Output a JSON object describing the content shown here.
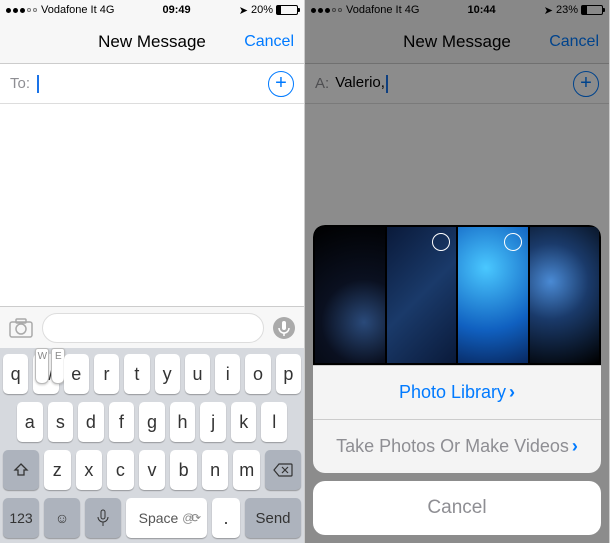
{
  "left": {
    "status": {
      "carrier": "Vodafone It 4G",
      "time": "09:49",
      "battery": "20%",
      "battery_fill": 20
    },
    "nav": {
      "title": "New Message",
      "cancel": "Cancel"
    },
    "to": {
      "label": "To:",
      "value": ""
    },
    "keyboard": {
      "row1": [
        "q",
        "w",
        "e",
        "r",
        "t",
        "y",
        "u",
        "i",
        "o",
        "p"
      ],
      "popup_w": [
        "W",
        "E"
      ],
      "row2": [
        "a",
        "s",
        "d",
        "f",
        "g",
        "h",
        "j",
        "k",
        "l"
      ],
      "row3": [
        "z",
        "x",
        "c",
        "v",
        "b",
        "n",
        "m"
      ],
      "num_key": "123",
      "space": "Space",
      "space_suffix": "@",
      "period": ".",
      "send": "Send"
    }
  },
  "right": {
    "status": {
      "carrier": "Vodafone It 4G",
      "time": "10:44",
      "battery": "23%",
      "battery_fill": 23
    },
    "nav": {
      "title": "New Message",
      "cancel": "Cancel"
    },
    "to": {
      "label": "A:",
      "value": "Valerio,"
    },
    "sheet": {
      "photo_library": "Photo Library",
      "take_photos": "Take Photos Or Make Videos",
      "cancel": "Cancel"
    }
  },
  "colors": {
    "accent": "#007aff",
    "gray": "#8e8e93"
  }
}
